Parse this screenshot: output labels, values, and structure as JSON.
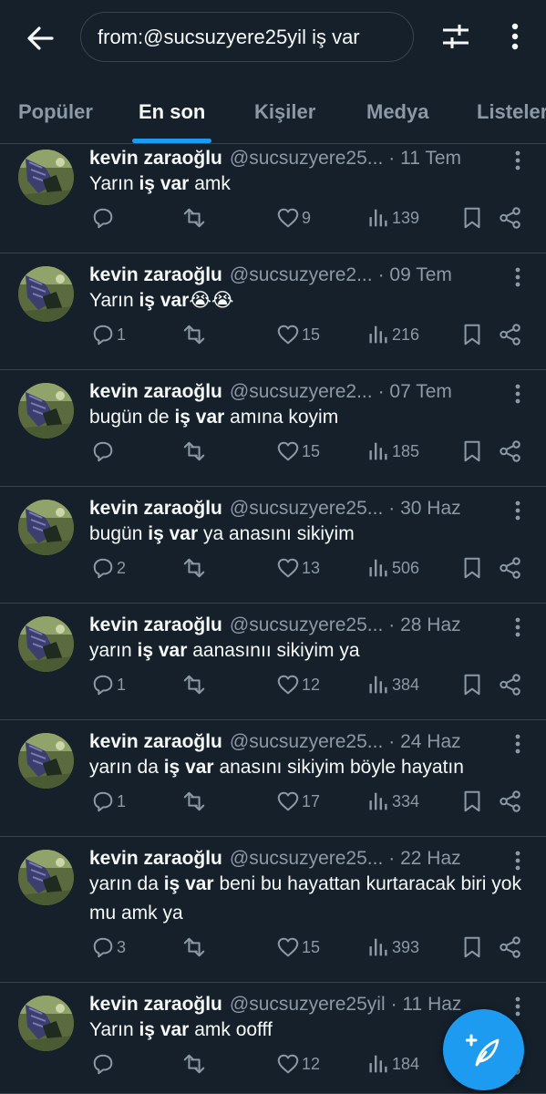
{
  "header": {
    "search_query": "from:@sucsuzyere25yil iş var"
  },
  "tabs": [
    {
      "label": "Popüler",
      "active": false
    },
    {
      "label": "En son",
      "active": true
    },
    {
      "label": "Kişiler",
      "active": false
    },
    {
      "label": "Medya",
      "active": false
    },
    {
      "label": "Listeler",
      "active": false
    }
  ],
  "colors": {
    "background": "#15202b",
    "accent": "#1d9bf0",
    "text_primary": "#f7f9f9",
    "text_secondary": "#8b98a5",
    "divider": "#38444d"
  },
  "tweets": [
    {
      "author": "kevin zaraoğlu",
      "handle": "@sucsuzyere25...",
      "date": "· 11 Tem",
      "text_before": "Yarın ",
      "highlight": "iş var",
      "text_after": " amk",
      "replies": "",
      "likes": "9",
      "views": "139"
    },
    {
      "author": "kevin zaraoğlu",
      "handle": "@sucsuzyere2...",
      "date": "· 09 Tem",
      "text_before": "Yarın ",
      "highlight": "iş var",
      "text_after": "😭😭",
      "replies": "1",
      "likes": "15",
      "views": "216"
    },
    {
      "author": "kevin zaraoğlu",
      "handle": "@sucsuzyere2...",
      "date": "· 07 Tem",
      "text_before": "bugün de ",
      "highlight": "iş var",
      "text_after": " amına koyim",
      "replies": "",
      "likes": "15",
      "views": "185"
    },
    {
      "author": "kevin zaraoğlu",
      "handle": "@sucsuzyere25...",
      "date": "· 30 Haz",
      "text_before": "bugün ",
      "highlight": "iş var",
      "text_after": " ya anasını sikiyim",
      "replies": "2",
      "likes": "13",
      "views": "506"
    },
    {
      "author": "kevin zaraoğlu",
      "handle": "@sucsuzyere25...",
      "date": "· 28 Haz",
      "text_before": "yarın ",
      "highlight": "iş var",
      "text_after": " aanasınıı sikiyim ya",
      "replies": "1",
      "likes": "12",
      "views": "384"
    },
    {
      "author": "kevin zaraoğlu",
      "handle": "@sucsuzyere25...",
      "date": "· 24 Haz",
      "text_before": "yarın da ",
      "highlight": "iş var",
      "text_after": " anasını sikiyim böyle hayatın",
      "replies": "1",
      "likes": "17",
      "views": "334"
    },
    {
      "author": "kevin zaraoğlu",
      "handle": "@sucsuzyere25...",
      "date": "· 22 Haz",
      "text_before": "yarın da ",
      "highlight": "iş var",
      "text_after": " beni bu hayattan kurtaracak biri yok mu amk ya",
      "replies": "3",
      "likes": "15",
      "views": "393"
    },
    {
      "author": "kevin zaraoğlu",
      "handle": "@sucsuzyere25yil",
      "date": "· 11 Haz",
      "text_before": "Yarın ",
      "highlight": "iş var",
      "text_after": " amk oofff",
      "replies": "",
      "likes": "12",
      "views": "184"
    }
  ],
  "icons": {
    "back": "arrow-left-icon",
    "filter": "sliders-icon",
    "more": "more-vertical-icon",
    "reply": "reply-icon",
    "retweet": "retweet-icon",
    "like": "heart-icon",
    "views": "views-icon",
    "bookmark": "bookmark-icon",
    "share": "share-icon",
    "compose": "compose-post-icon"
  }
}
